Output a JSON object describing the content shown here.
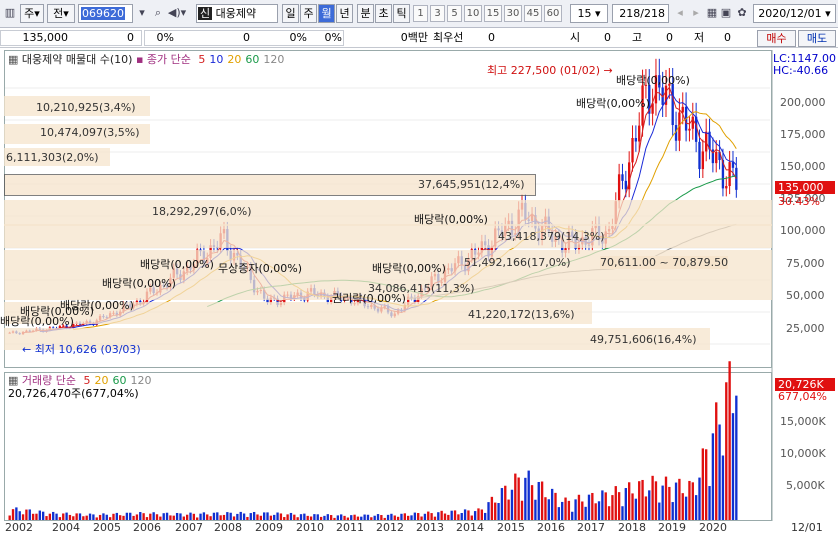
{
  "toolbar": {
    "market": "주",
    "period_prefix": "전",
    "code": "069620",
    "name_badge": "신",
    "name": "대웅제약",
    "periods": [
      {
        "label": "일"
      },
      {
        "label": "주"
      },
      {
        "label": "월",
        "selected": true
      },
      {
        "label": "년"
      },
      {
        "label": "분"
      },
      {
        "label": "초"
      },
      {
        "label": "틱"
      }
    ],
    "intervals": [
      "1",
      "3",
      "5",
      "10",
      "15",
      "30",
      "45",
      "60"
    ],
    "interval_value": "15",
    "count": "218",
    "count_total": "/218",
    "date": "2020/12/01"
  },
  "quote": {
    "price": "135,000",
    "change": "0",
    "pct1": "0%",
    "volume": "0",
    "pct2": "0%",
    "pct3": "0%",
    "amount": "0백만",
    "best_ask_label": "최우선",
    "best_ask": "0",
    "open_label": "시",
    "open": "0",
    "high_label": "고",
    "high": "0",
    "low_label": "저",
    "low": "0",
    "buy": "매수",
    "sell": "매도"
  },
  "price_panel": {
    "legend_name": "대웅제약 매물대 수(10)",
    "legend_ma_label": "종가 단순",
    "ma": [
      {
        "label": "5",
        "color": "#d42020"
      },
      {
        "label": "10",
        "color": "#1a2ad8"
      },
      {
        "label": "20",
        "color": "#e0a000"
      },
      {
        "label": "60",
        "color": "#1a9a4a"
      },
      {
        "label": "120",
        "color": "#888888"
      }
    ],
    "lc": "LC:1147.00",
    "hc": "HC:-40.66",
    "last_price": "135,000",
    "last_pct": "30.43%",
    "y_ticks": [
      "200,000",
      "175,000",
      "150,000",
      "125,000",
      "100,000",
      "75,000",
      "50,000",
      "25,000"
    ],
    "y_max": 227500,
    "y_min": 0,
    "high_label": "최고 227,500 (01/02)",
    "low_label": "최저 10,626 (03/03)",
    "range_label": "70,611.00 ~ 70,879.50",
    "volume_bands": [
      "10,210,925(3,4%)",
      "10,474,097(3,5%)",
      "6,111,303(2,0%)",
      "37,645,951(12,4%)",
      "18,292,297(6,0%)",
      "43,418,379(14,3%)",
      "51,492,166(17,0%)",
      "34,086,415(11,3%)",
      "41,220,172(13,6%)",
      "49,751,606(16,4%)"
    ],
    "events": [
      "배당락(0,00%)",
      "배당락(0,00%)",
      "배당락(0,00%)",
      "배당락(0,00%)",
      "배당락(0,00%)",
      "배당락(0,00%)",
      "무상증자(0,00%)",
      "권리락(0,00%)",
      "배당락(0,00%)",
      "배당락(0,00%)",
      "배당락(0,00%)"
    ]
  },
  "volume_panel": {
    "legend_name": "거래량",
    "legend_ma_label": "단순",
    "ma": [
      {
        "label": "5",
        "color": "#d42020"
      },
      {
        "label": "20",
        "color": "#e0a000"
      },
      {
        "label": "60",
        "color": "#1a9a4a"
      },
      {
        "label": "120",
        "color": "#888888"
      }
    ],
    "last_volume_text": "20,726,470주(677,04%)",
    "last_value": "20,726K",
    "last_pct": "677,04%",
    "y_ticks": [
      "15,000K",
      "10,000K",
      "5,000K"
    ]
  },
  "x_axis": {
    "ticks": [
      "2002",
      "2004",
      "2005",
      "2006",
      "2007",
      "2008",
      "2009",
      "2010",
      "2011",
      "2012",
      "2013",
      "2014",
      "2015",
      "2016",
      "2017",
      "2018",
      "2019",
      "2020"
    ],
    "right_label": "12/01"
  },
  "chart_data": {
    "type": "candlestick",
    "title": "대웅제약",
    "x_range": [
      "2002",
      "2020/12"
    ],
    "ylim": [
      0,
      227500
    ],
    "series": [
      {
        "name": "price",
        "x": [
          "2002",
          "2004",
          "2005",
          "2006",
          "2007",
          "2008",
          "2009",
          "2010",
          "2011",
          "2012",
          "2013",
          "2014",
          "2015",
          "2016",
          "2017",
          "2018",
          "2019",
          "2020"
        ],
        "values": [
          12000,
          16000,
          22000,
          38000,
          62000,
          90000,
          38000,
          45000,
          40000,
          28000,
          58000,
          80000,
          110000,
          85000,
          95000,
          220000,
          175000,
          135000
        ]
      },
      {
        "name": "volume",
        "unit": "K",
        "x": [
          "2002",
          "2004",
          "2005",
          "2006",
          "2007",
          "2008",
          "2009",
          "2010",
          "2011",
          "2012",
          "2013",
          "2014",
          "2015",
          "2016",
          "2017",
          "2018",
          "2019",
          "2020"
        ],
        "values": [
          1500,
          900,
          700,
          900,
          800,
          900,
          900,
          700,
          600,
          700,
          1000,
          1300,
          6000,
          2500,
          3500,
          5000,
          4500,
          20726
        ]
      }
    ],
    "colors": {
      "up": "#e01010",
      "down": "#1030d0"
    }
  }
}
